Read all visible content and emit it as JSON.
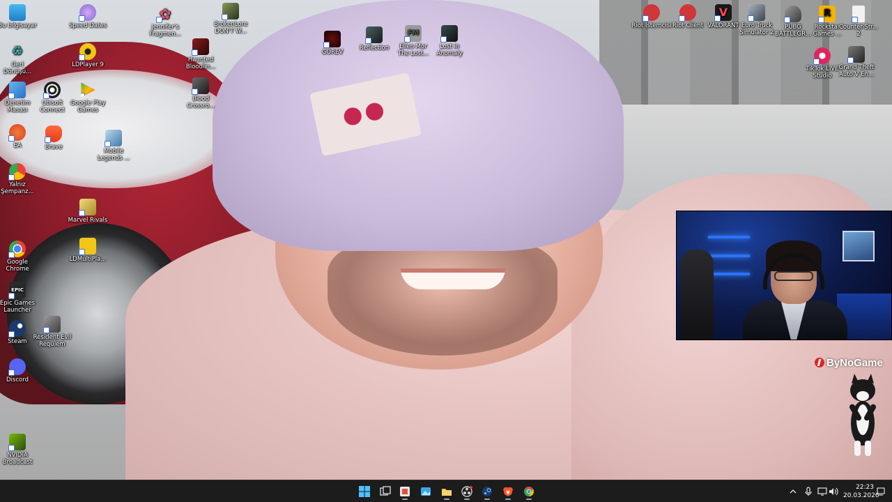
{
  "desktop": {
    "icons": [
      {
        "id": "bu-bilgisayar",
        "label": "Bu bilgisayar",
        "icon": "monitor-icon",
        "color": "#2aa3e0"
      },
      {
        "id": "geri-donusum",
        "label": "Geri\nDönüşü...",
        "icon": "recycle-bin-icon",
        "color": "#dfe9f2"
      },
      {
        "id": "denetim-masasi",
        "label": "Denetim\nMasası",
        "icon": "control-panel-icon",
        "color": "#3d8fd8"
      },
      {
        "id": "ea",
        "label": "EA",
        "icon": "ea-logo-icon",
        "color": "#e8572a"
      },
      {
        "id": "yalniz-sempanze",
        "label": "Yalnız\nŞempanz...",
        "icon": "chrome-profile-icon",
        "color": "#4285f4"
      },
      {
        "id": "google-chrome",
        "label": "Google\nChrome",
        "icon": "chrome-icon",
        "color": "#4285f4"
      },
      {
        "id": "epic-games",
        "label": "Epic Games\nLauncher",
        "icon": "epic-games-icon",
        "color": "#2a2a2a"
      },
      {
        "id": "steam",
        "label": "Steam",
        "icon": "steam-icon",
        "color": "#1b3a6b"
      },
      {
        "id": "discord",
        "label": "Discord",
        "icon": "discord-icon",
        "color": "#5865f2"
      },
      {
        "id": "nvidia-broadcast",
        "label": "NVIDIA\nBroadcast",
        "icon": "nvidia-icon",
        "color": "#2d4a16"
      },
      {
        "id": "speed-dates",
        "label": "Speed Dates",
        "icon": "game-icon",
        "color": "#7b6bd4"
      },
      {
        "id": "ldplayer9",
        "label": "LDPlayer 9",
        "icon": "ldplayer-icon",
        "color": "#f2c614"
      },
      {
        "id": "ubisoft-connect",
        "label": "Ubisoft\nConnect",
        "icon": "ubisoft-icon",
        "color": "#1d1d1d"
      },
      {
        "id": "google-play-games",
        "label": "Google Play\nGames",
        "icon": "google-play-icon",
        "color": "#34a853"
      },
      {
        "id": "brave",
        "label": "Brave",
        "icon": "brave-icon",
        "color": "#fb542b"
      },
      {
        "id": "resident-evil",
        "label": "Resident Evil\nRequiem",
        "icon": "game-icon",
        "color": "#6d6d6d"
      },
      {
        "id": "marvel-rivals",
        "label": "Marvel Rivals",
        "icon": "game-icon",
        "color": "#d9c25a"
      },
      {
        "id": "ldmultiplayer",
        "label": "LDMultiPla...",
        "icon": "ldplayer-icon",
        "color": "#f2c614"
      },
      {
        "id": "mobile-legends",
        "label": "Mobile\nLegends ...",
        "icon": "game-icon",
        "color": "#6aa0c8"
      },
      {
        "id": "jennifers-fragments",
        "label": "Jennifer's\nFragmen...",
        "icon": "game-icon",
        "color": "#d8536b"
      },
      {
        "id": "haunted-bloodlines",
        "label": "Haunted\nBloodlin...",
        "icon": "game-icon",
        "color": "#5a1212"
      },
      {
        "id": "blood-crossroads",
        "label": "Blood\nCrossro...",
        "icon": "game-icon",
        "color": "#3a3a3a"
      },
      {
        "id": "brokenlore",
        "label": "BrokenLore\nDON'T W...",
        "icon": "game-icon",
        "color": "#3f4a2a"
      },
      {
        "id": "gorev",
        "label": "GÖREV",
        "icon": "game-icon",
        "color": "#1a0a0a"
      },
      {
        "id": "reflection",
        "label": "Reflection",
        "icon": "game-icon",
        "color": "#2d3a3a"
      },
      {
        "id": "ellen-mor",
        "label": "Ellen Mor\nThe Lost...",
        "icon": "game-icon",
        "color": "#8a8a8a"
      },
      {
        "id": "lost-in-anomaly",
        "label": "Lost in\nAnomaly",
        "icon": "game-icon",
        "color": "#1f2a2a"
      },
      {
        "id": "riot-istemcisi",
        "label": "Riot İstemcisi",
        "icon": "riot-icon",
        "color": "#d13639"
      },
      {
        "id": "riot-client",
        "label": "Riot Client",
        "icon": "riot-icon",
        "color": "#d13639"
      },
      {
        "id": "valorant",
        "label": "VALORANT",
        "icon": "valorant-icon",
        "color": "#1a1a1a"
      },
      {
        "id": "euro-truck",
        "label": "Euro Truck\nSimulator 2",
        "icon": "truck-icon",
        "color": "#3a4550"
      },
      {
        "id": "pubg",
        "label": "PUBG\nBATTLEGR...",
        "icon": "pubg-icon",
        "color": "#5a5a5a"
      },
      {
        "id": "rockstar",
        "label": "Rockstar\nGames ...",
        "icon": "rockstar-icon",
        "color": "#f5b400"
      },
      {
        "id": "counter-strike",
        "label": "Counter-Str...\n2",
        "icon": "file-icon",
        "color": "#f2f2f2"
      },
      {
        "id": "tiktok-live",
        "label": "TikTok LIVE\nStudio",
        "icon": "tiktok-icon",
        "color": "#e0245e"
      },
      {
        "id": "gta-v",
        "label": "Grand Theft\nAuto V En...",
        "icon": "gta-icon",
        "color": "#3c3c3c"
      }
    ]
  },
  "overlay": {
    "watermark": "ByNoGame",
    "colors": {
      "brand_red": "#e02424"
    }
  },
  "taskbar": {
    "apps": [
      {
        "id": "start",
        "icon": "windows-start-icon",
        "color": "#4cc2ff"
      },
      {
        "id": "task-view",
        "icon": "task-view-icon",
        "color": "#cfd3d8"
      },
      {
        "id": "app-3",
        "icon": "settings-app-icon",
        "color": "#e94e3c"
      },
      {
        "id": "app-4",
        "icon": "photos-icon",
        "color": "#3ea6e6"
      },
      {
        "id": "file-explorer",
        "icon": "folder-icon",
        "color": "#f2c14e"
      },
      {
        "id": "app-6",
        "icon": "obs-icon",
        "color": "#d0d0d0"
      },
      {
        "id": "steam",
        "icon": "steam-icon",
        "color": "#66c0f4"
      },
      {
        "id": "brave",
        "icon": "brave-icon",
        "color": "#fb542b"
      },
      {
        "id": "chrome",
        "icon": "chrome-icon",
        "color": "#4285f4"
      }
    ],
    "clock": {
      "time": "22:23",
      "date": "20.03.2026"
    }
  }
}
